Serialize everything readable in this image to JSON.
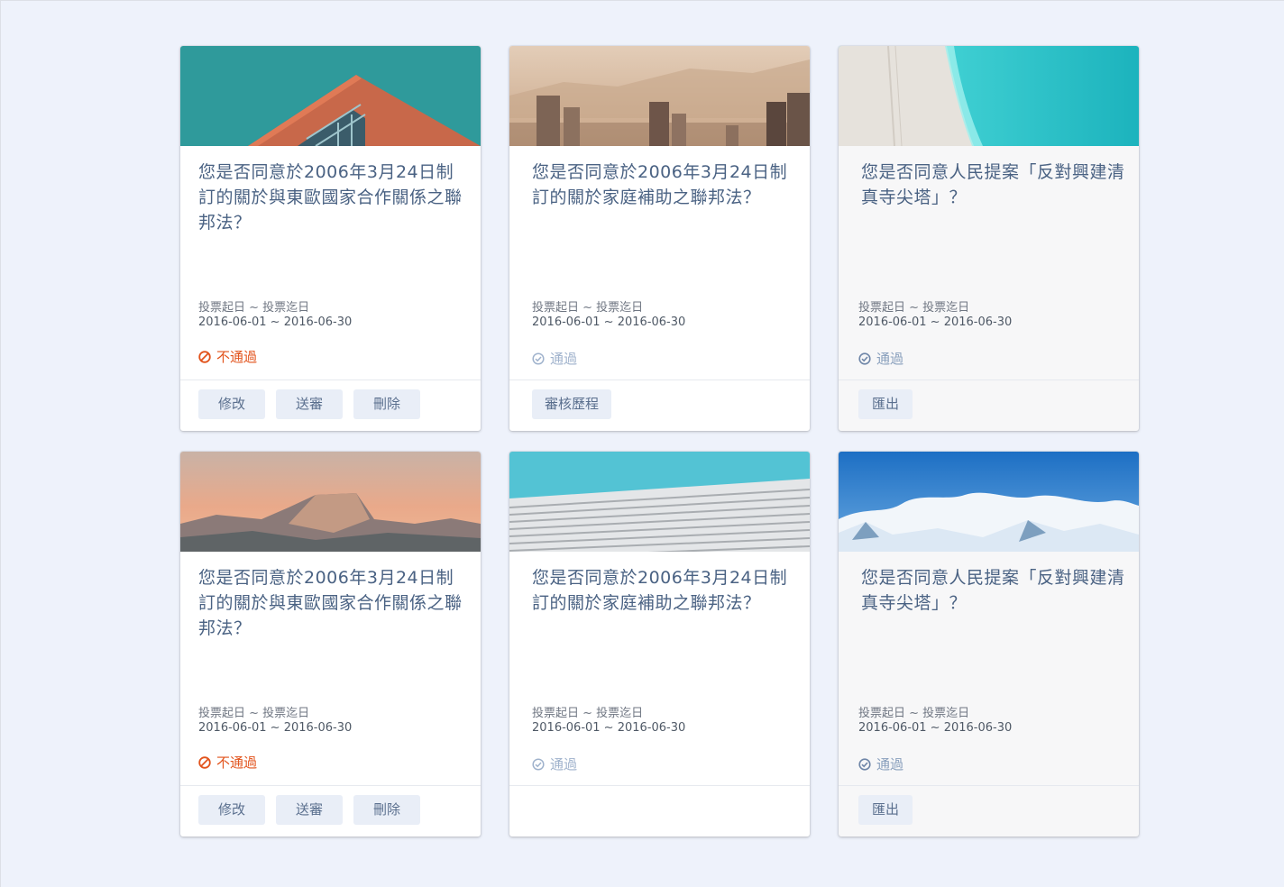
{
  "colors": {
    "background": "#eef2fb",
    "title": "#4a6283",
    "fail": "#e2531c",
    "pass": "#9fb2cc",
    "button_bg": "#e9eef7",
    "button_text": "#5a6f8e"
  },
  "cards": [
    {
      "cover_icon": "building-image",
      "title": "您是否同意於2006年3月24日制訂的關於與東歐國家合作關係之聯邦法？",
      "period_label": "投票起日 ~ 投票迄日",
      "period_value": "2016-06-01 ~ 2016-06-30",
      "status_label": "不通過",
      "status_icon": "ban-icon",
      "actions": [
        "修改",
        "送審",
        "刪除"
      ]
    },
    {
      "cover_icon": "city-fog-image",
      "title": "您是否同意於2006年3月24日制訂的關於家庭補助之聯邦法？",
      "period_label": "投票起日 ~ 投票迄日",
      "period_value": "2016-06-01 ~ 2016-06-30",
      "status_label": "通過",
      "status_icon": "check-circle-icon",
      "actions": [
        "審核歷程"
      ]
    },
    {
      "cover_icon": "beach-image",
      "title": "您是否同意人民提案「反對興建清真寺尖塔」？",
      "period_label": "投票起日 ~ 投票迄日",
      "period_value": "2016-06-01 ~ 2016-06-30",
      "status_label": "通過",
      "status_icon": "check-circle-icon",
      "actions": [
        "匯出"
      ]
    },
    {
      "cover_icon": "mountain-dome-image",
      "title": "您是否同意於2006年3月24日制訂的關於與東歐國家合作關係之聯邦法？",
      "period_label": "投票起日 ~ 投票迄日",
      "period_value": "2016-06-01 ~ 2016-06-30",
      "status_label": "不通過",
      "status_icon": "ban-icon",
      "actions": [
        "修改",
        "送審",
        "刪除"
      ]
    },
    {
      "cover_icon": "striped-wall-image",
      "title": "您是否同意於2006年3月24日制訂的關於家庭補助之聯邦法？",
      "period_label": "投票起日 ~ 投票迄日",
      "period_value": "2016-06-01 ~ 2016-06-30",
      "status_label": "通過",
      "status_icon": "check-circle-icon",
      "actions": []
    },
    {
      "cover_icon": "snowy-mountains-image",
      "title": "您是否同意人民提案「反對興建清真寺尖塔」？",
      "period_label": "投票起日 ~ 投票迄日",
      "period_value": "2016-06-01 ~ 2016-06-30",
      "status_label": "通過",
      "status_icon": "check-circle-icon",
      "actions": [
        "匯出"
      ]
    }
  ]
}
